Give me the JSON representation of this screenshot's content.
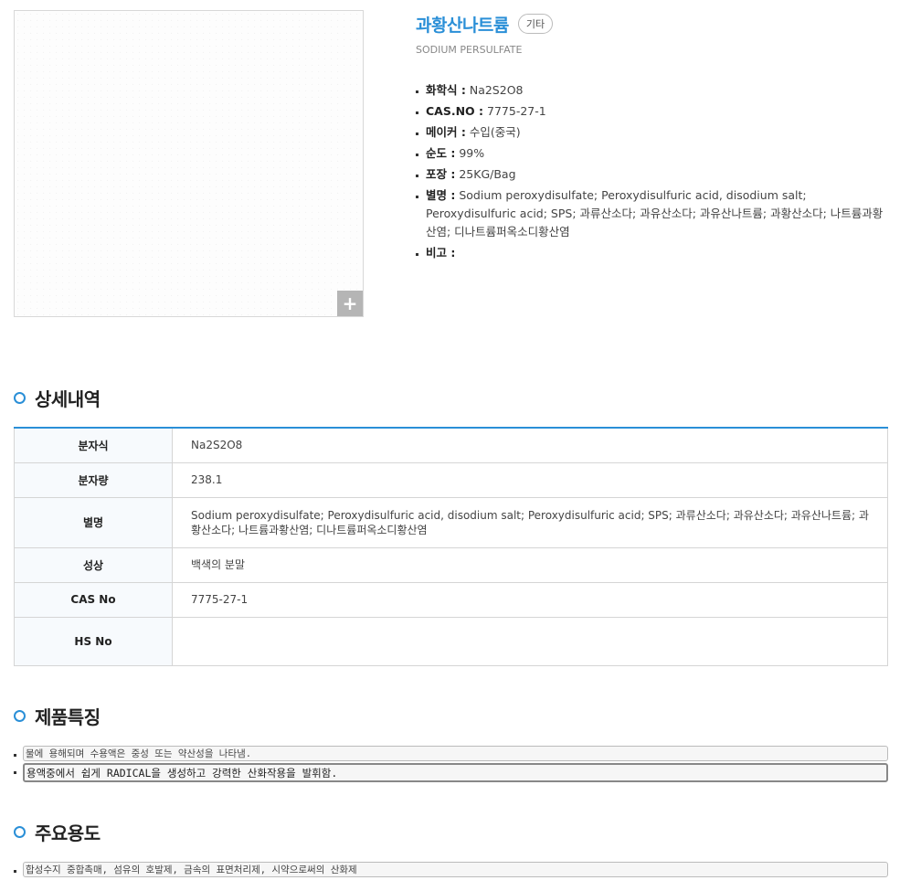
{
  "product": {
    "name": "과황산나트륨",
    "badge": "기타",
    "english_name": "SODIUM PERSULFATE",
    "zoom_symbol": "+"
  },
  "specs": [
    {
      "key": "화학식 :",
      "value": "Na2S2O8"
    },
    {
      "key": "CAS.NO :",
      "value": "7775-27-1"
    },
    {
      "key": "메이커 :",
      "value": "수입(중국)"
    },
    {
      "key": "순도 :",
      "value": "99%"
    },
    {
      "key": "포장 :",
      "value": "25KG/Bag"
    },
    {
      "key": "별명 :",
      "value": "Sodium peroxydisulfate; Peroxydisulfuric acid, disodium salt; Peroxydisulfuric acid; SPS; 과류산소다; 과유산소다; 과유산나트륨; 과황산소다; 나트륨과황산염; 디나트륨퍼옥소디황산염"
    },
    {
      "key": "비고 :",
      "value": ""
    }
  ],
  "detail": {
    "title": "상세내역",
    "rows": [
      {
        "label": "분자식",
        "value": "Na2S2O8"
      },
      {
        "label": "분자량",
        "value": "238.1"
      },
      {
        "label": "별명",
        "value": "Sodium peroxydisulfate; Peroxydisulfuric acid, disodium salt; Peroxydisulfuric acid; SPS; 과류산소다; 과유산소다; 과유산나트륨; 과황산소다; 나트륨과황산염; 디나트륨퍼옥소디황산염"
      },
      {
        "label": "성상",
        "value": "백색의 분말"
      },
      {
        "label": "CAS No",
        "value": "7775-27-1"
      },
      {
        "label": "HS No",
        "value": ""
      }
    ]
  },
  "features": {
    "title": "제품특징",
    "items": [
      "물에 용해되며 수용액은 중성 또는 약산성을 나타냄.",
      "용액중에서 쉽게 RADICAL을 생성하고 강력한 산화작용을 발휘함."
    ]
  },
  "uses": {
    "title": "주요용도",
    "items": [
      "합성수지 중합촉매, 섬유의 호발제, 금속의 표면처리제, 시약으로써의 산화제"
    ]
  }
}
